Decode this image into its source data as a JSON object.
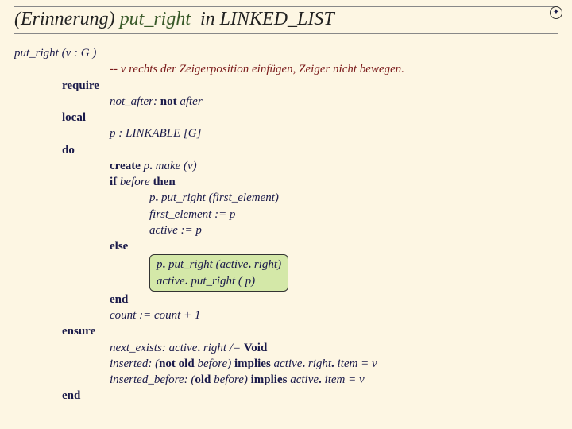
{
  "title": {
    "prefix": "(Erinnerung)",
    "method": "put_right",
    "mid": "in",
    "class": "LINKED_LIST"
  },
  "code": {
    "sig_a": "put_right",
    "sig_b": "(",
    "sig_c": "v",
    "sig_d": ":",
    "sig_e": "G )",
    "comment": "-- v rechts der Zeigerposition einfügen, Zeiger nicht bewegen.",
    "require": "require",
    "req1a": "not_after:",
    "req1b": "not",
    "req1c": "after",
    "local": "local",
    "local1": "p : LINKABLE [G]",
    "do": "do",
    "do1a": "create",
    "do1b": "p",
    "do1c": "make (v)",
    "do2a": "if",
    "do2b": "before",
    "do2c": "then",
    "do3a": "p",
    "do3b": "put_right (first_element)",
    "do4": "first_element := p",
    "do5": "active := p",
    "else": "else",
    "hi1a": "p",
    "hi1b": "put_right (active",
    "hi1c": "right)",
    "hi2a": "active",
    "hi2b": "put_right ( p)",
    "end1": "end",
    "count": "count := count + 1",
    "ensure": "ensure",
    "en1a": "next_exists:",
    "en1b": "active",
    "en1c": "right /=",
    "en1d": "Void",
    "en2a": "inserted: (",
    "en2b": "not",
    "en2c": "old",
    "en2d": "before)",
    "en2e": "implies",
    "en2f": "active",
    "en2g": "right",
    "en2h": "item = v",
    "en3a": "inserted_before: (",
    "en3b": "old",
    "en3c": "before)",
    "en3d": "implies",
    "en3e": "active",
    "en3f": "item = v",
    "end2": "end"
  }
}
